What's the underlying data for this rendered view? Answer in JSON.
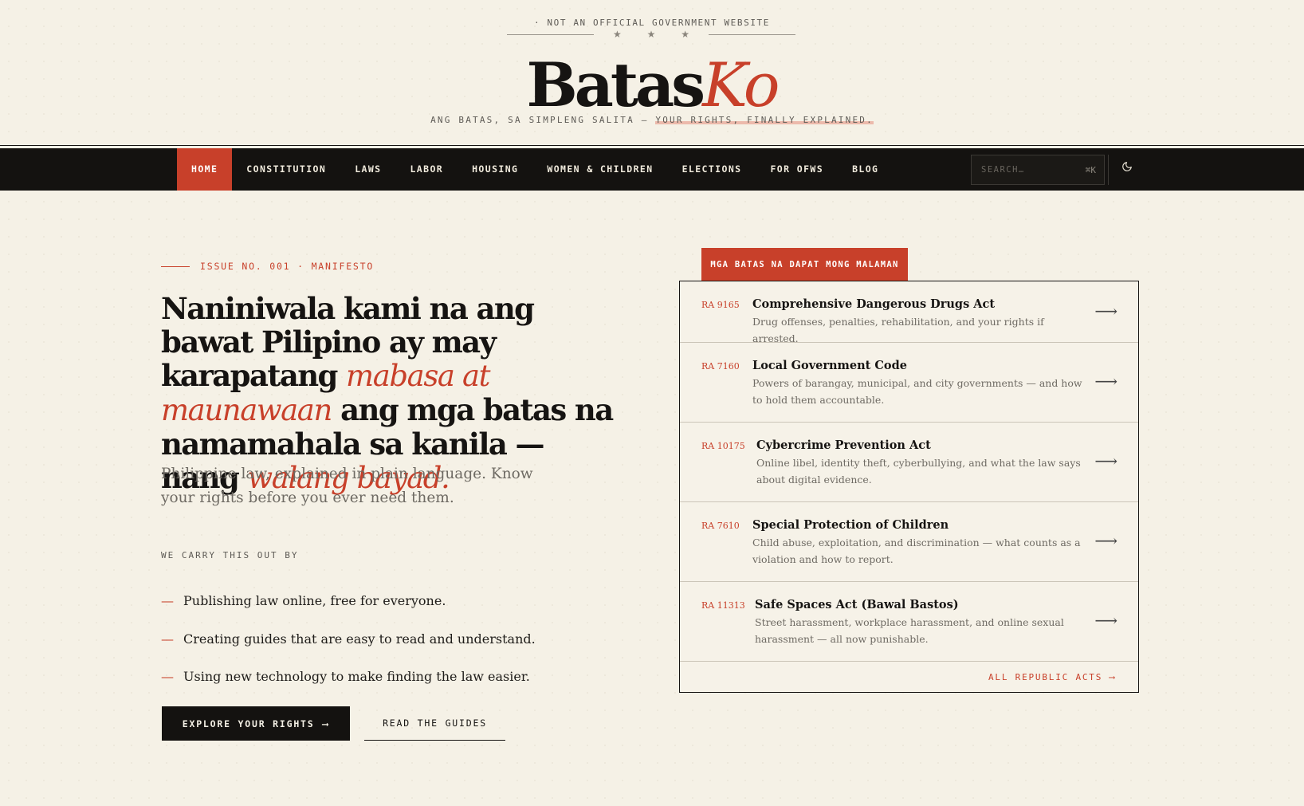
{
  "banner": {
    "notice": "· NOT AN OFFICIAL GOVERNMENT WEBSITE",
    "stars": "★ ★ ★"
  },
  "logo": {
    "main": "Batas",
    "accent": "Ko"
  },
  "tagline": {
    "prefix": "ANG BATAS, SA SIMPLENG SALITA — ",
    "highlight": "YOUR RIGHTS, FINALLY EXPLAINED."
  },
  "nav": {
    "items": [
      {
        "label": "HOME",
        "active": true
      },
      {
        "label": "CONSTITUTION"
      },
      {
        "label": "LAWS"
      },
      {
        "label": "LABOR"
      },
      {
        "label": "HOUSING"
      },
      {
        "label": "WOMEN & CHILDREN"
      },
      {
        "label": "ELECTIONS"
      },
      {
        "label": "FOR OFWS"
      },
      {
        "label": "BLOG"
      }
    ],
    "search_placeholder": "SEARCH…",
    "search_shortcut": "⌘K",
    "theme_icon": "moon-icon"
  },
  "hero": {
    "issue": "ISSUE NO. 001 · MANIFESTO",
    "headline": {
      "part1": "Naniniwala kami na ang bawat Pilipino ay may karapatang ",
      "italic1": "mabasa at maunawaan",
      "part2": " ang mga batas na namamahala sa kanila — nang ",
      "italic2": "walang bayad."
    },
    "subhead": "Philippine law, explained in plain language. Know your rights before you ever need them.",
    "carry_label": "WE CARRY THIS OUT BY",
    "bullets": [
      "Publishing law online, free for everyone.",
      "Creating guides that are easy to read and understand.",
      "Using new technology to make finding the law easier."
    ],
    "bullet_dash": "—",
    "primary_button": "EXPLORE YOUR RIGHTS",
    "primary_arrow": "⟶",
    "secondary_button": "READ THE GUIDES"
  },
  "panel": {
    "tab": "MGA BATAS NA DAPAT MONG MALAMAN",
    "arrow": "⟶",
    "laws": [
      {
        "ra": "RA 9165",
        "title": "Comprehensive Dangerous Drugs Act",
        "desc": "Drug offenses, penalties, rehabilitation, and your rights if arrested."
      },
      {
        "ra": "RA 7160",
        "title": "Local Government Code",
        "desc": "Powers of barangay, municipal, and city governments — and how to hold them accountable."
      },
      {
        "ra": "RA 10175",
        "title": "Cybercrime Prevention Act",
        "desc": "Online libel, identity theft, cyberbullying, and what the law says about digital evidence."
      },
      {
        "ra": "RA 7610",
        "title": "Special Protection of Children",
        "desc": "Child abuse, exploitation, and discrimination — what counts as a violation and how to report."
      },
      {
        "ra": "RA 11313",
        "title": "Safe Spaces Act (Bawal Bastos)",
        "desc": "Street harassment, workplace harassment, and online sexual harassment — all now punishable."
      }
    ],
    "footer_link": "ALL REPUBLIC ACTS ⟶"
  },
  "colors": {
    "accent": "#c8402a",
    "ink": "#161412",
    "paper": "#f5f1e6"
  }
}
